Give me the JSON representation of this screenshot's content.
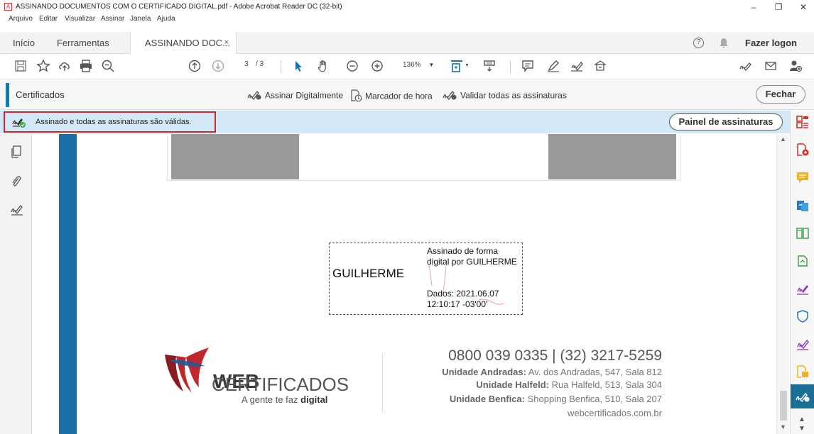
{
  "window": {
    "title": "ASSINANDO DOCUMENTOS COM O CERTIFICADO DIGITAL.pdf - Adobe Acrobat Reader DC (32-bit)",
    "minimize": "–",
    "restore": "❐",
    "close": "✕"
  },
  "menu": [
    "Arquivo",
    "Editar",
    "Visualizar",
    "Assinar",
    "Janela",
    "Ajuda"
  ],
  "tabs": {
    "home": "Início",
    "tools": "Ferramentas",
    "document": "ASSINANDO DOC...",
    "close": "×"
  },
  "header": {
    "help": "?",
    "login": "Fazer logon"
  },
  "toolbar": {
    "page_current": "3",
    "page_total": "/ 3",
    "zoom": "136%"
  },
  "certificates": {
    "title": "Certificados",
    "sign_digitally": "Assinar Digitalmente",
    "timestamp": "Marcador de hora",
    "validate_all": "Validar todas as assinaturas",
    "close": "Fechar"
  },
  "signature_status": {
    "text": "Assinado e todas as assinaturas são válidas.",
    "panel_button": "Painel de assinaturas"
  },
  "document": {
    "signature": {
      "name": "GUILHERME",
      "line1": "Assinado de forma",
      "line2": "digital por GUILHERME",
      "line3": "Dados: 2021.06.07",
      "line4": "12:10:17 -03'00'"
    },
    "logo": {
      "web": "WEB",
      "certificados": "CERTIFICADOS",
      "tagline_pre": "A gente te faz",
      "tagline_bold": "digital"
    },
    "contact": {
      "phone": "0800 039 0335 | (32) 3217-5259",
      "unit1_label": "Unidade Andradas:",
      "unit1_address": "Av. dos Andradas, 547, Sala 812",
      "unit2_label": "Unidade Halfeld:",
      "unit2_address": "Rua Halfeld, 513, Sala 304",
      "unit3_label": "Unidade Benfica:",
      "unit3_address": "Shopping Benfica, 510, Sala 207",
      "website": "webcertificados.com.br"
    }
  },
  "colors": {
    "accent_blue": "#1b6fa8",
    "status_bar": "#d4e9f7",
    "highlight_red": "#d9252a",
    "logo_red": "#c0272d",
    "tool_active": "#1a6f96"
  }
}
